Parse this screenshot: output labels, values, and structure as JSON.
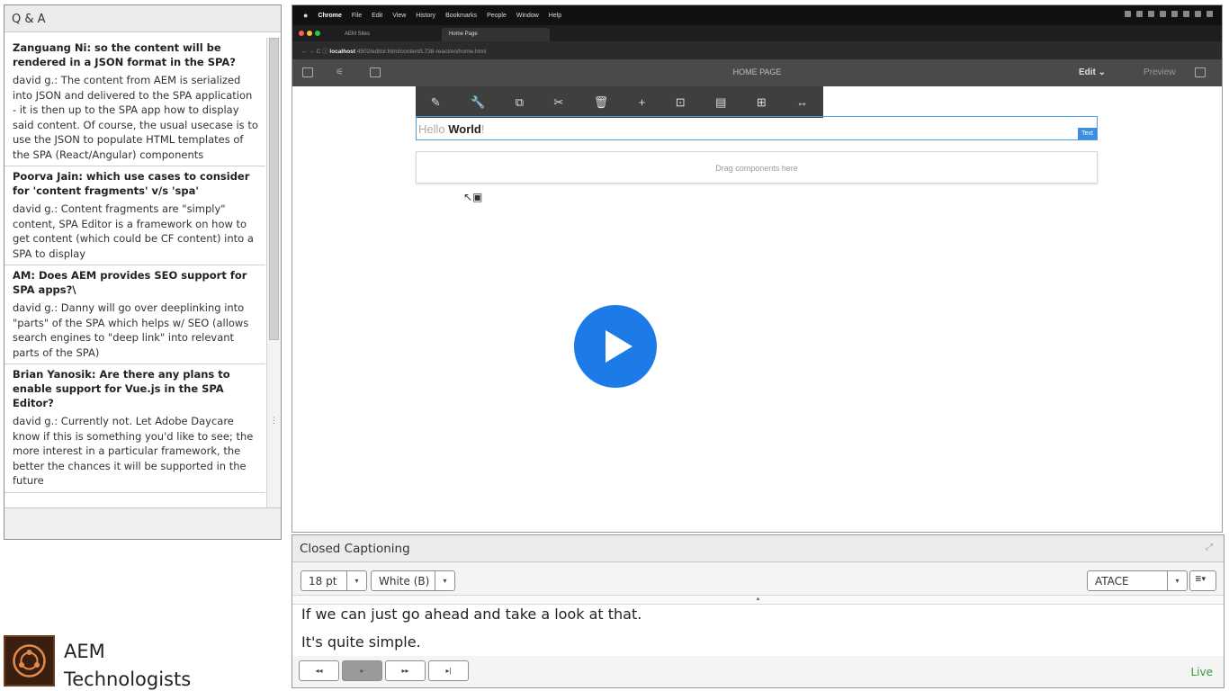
{
  "qa": {
    "title": "Q & A",
    "items": [
      {
        "question": "Zanguang Ni: so the content will be rendered in a JSON format in the SPA?",
        "answer": "david g.: The content from AEM is serialized into JSON and delivered to the SPA application - it is then up to the SPA app how to display said content. Of course, the usual usecase is to use the JSON to populate HTML templates of the SPA (React/Angular) components"
      },
      {
        "question": "Poorva Jain: which use cases to consider for 'content fragments' v/s 'spa'",
        "answer": "david g.: Content fragments are \"simply\" content, SPA Editor is a framework on how to get content (which could be CF content) into a SPA to display"
      },
      {
        "question": "AM: Does AEM provides SEO support for SPA apps?\\",
        "answer": "david g.: Danny will go over deeplinking into \"parts\" of the SPA which helps w/ SEO (allows search engines to \"deep link\" into relevant parts of the SPA)"
      },
      {
        "question": "Brian Yanosik: Are there any plans to enable support for Vue.js in the SPA Editor?",
        "answer": "david g.: Currently not.  Let Adobe Daycare know if this is something you'd like to see; the more interest in a particular framework, the better the chances it will be supported in the future"
      }
    ]
  },
  "logo": {
    "line1": "AEM",
    "line2": "Technologists"
  },
  "video": {
    "menubar": {
      "app": "Chrome",
      "items": [
        "File",
        "Edit",
        "View",
        "History",
        "Bookmarks",
        "People",
        "Window",
        "Help"
      ]
    },
    "tabs": [
      "AEM Sites",
      "Home Page"
    ],
    "url_host": "localhost",
    "url_path": ":4502/editor.html/content/L738-react/en/home.html",
    "page_title": "HOME PAGE",
    "edit_label": "Edit",
    "preview_label": "Preview",
    "component_text_light": "Hello ",
    "component_text_bold": "World",
    "component_text_end": "!",
    "component_tag": "Text",
    "dropzone_label": "Drag components here"
  },
  "cc": {
    "title": "Closed Captioning",
    "font_size": "18 pt",
    "color": "White (B)",
    "source": "ATACE",
    "lines": [
      "If we can just go ahead and take a look at that.",
      "It's quite simple."
    ],
    "status": "Live"
  },
  "colors": {
    "accent": "#1d7be8",
    "live": "#3a9a3a",
    "selection": "#4c9de0"
  }
}
